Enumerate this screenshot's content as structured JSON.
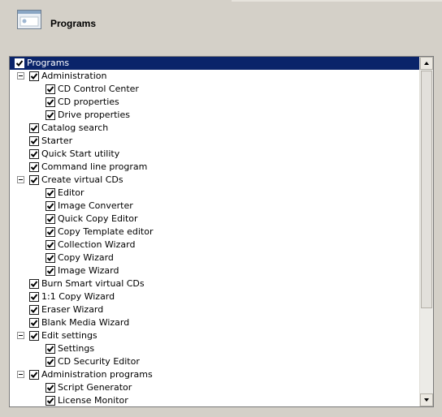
{
  "header": {
    "title": "Programs",
    "icon": "window-icon"
  },
  "tree": {
    "items": [
      {
        "label": "Programs",
        "level": 0,
        "checked": true,
        "expander": false,
        "selected": true
      },
      {
        "label": "Administration",
        "level": 1,
        "checked": true,
        "expander": true
      },
      {
        "label": "CD Control Center",
        "level": 2,
        "checked": true,
        "expander": false
      },
      {
        "label": "CD properties",
        "level": 2,
        "checked": true,
        "expander": false
      },
      {
        "label": "Drive properties",
        "level": 2,
        "checked": true,
        "expander": false
      },
      {
        "label": "Catalog search",
        "level": 1,
        "checked": true,
        "expander": false
      },
      {
        "label": "Starter",
        "level": 1,
        "checked": true,
        "expander": false
      },
      {
        "label": "Quick Start utility",
        "level": 1,
        "checked": true,
        "expander": false
      },
      {
        "label": "Command line program",
        "level": 1,
        "checked": true,
        "expander": false
      },
      {
        "label": "Create virtual CDs",
        "level": 1,
        "checked": true,
        "expander": true
      },
      {
        "label": "Editor",
        "level": 2,
        "checked": true,
        "expander": false
      },
      {
        "label": "Image Converter",
        "level": 2,
        "checked": true,
        "expander": false
      },
      {
        "label": "Quick Copy Editor",
        "level": 2,
        "checked": true,
        "expander": false
      },
      {
        "label": "Copy Template editor",
        "level": 2,
        "checked": true,
        "expander": false
      },
      {
        "label": "Collection Wizard",
        "level": 2,
        "checked": true,
        "expander": false
      },
      {
        "label": "Copy Wizard",
        "level": 2,
        "checked": true,
        "expander": false
      },
      {
        "label": "Image Wizard",
        "level": 2,
        "checked": true,
        "expander": false
      },
      {
        "label": "Burn Smart virtual CDs",
        "level": 1,
        "checked": true,
        "expander": false
      },
      {
        "label": "1:1 Copy Wizard",
        "level": 1,
        "checked": true,
        "expander": false
      },
      {
        "label": "Eraser Wizard",
        "level": 1,
        "checked": true,
        "expander": false
      },
      {
        "label": "Blank Media Wizard",
        "level": 1,
        "checked": true,
        "expander": false
      },
      {
        "label": "Edit settings",
        "level": 1,
        "checked": true,
        "expander": true
      },
      {
        "label": "Settings",
        "level": 2,
        "checked": true,
        "expander": false
      },
      {
        "label": "CD Security Editor",
        "level": 2,
        "checked": true,
        "expander": false
      },
      {
        "label": "Administration programs",
        "level": 1,
        "checked": true,
        "expander": true
      },
      {
        "label": "Script Generator",
        "level": 2,
        "checked": true,
        "expander": false
      },
      {
        "label": "License Monitor",
        "level": 2,
        "checked": true,
        "expander": false
      }
    ]
  },
  "scrollbar": {
    "up_icon": "arrow-up-icon",
    "down_icon": "arrow-down-icon"
  },
  "colors": {
    "selection": "#0a246a",
    "background": "#d4d0c8"
  }
}
